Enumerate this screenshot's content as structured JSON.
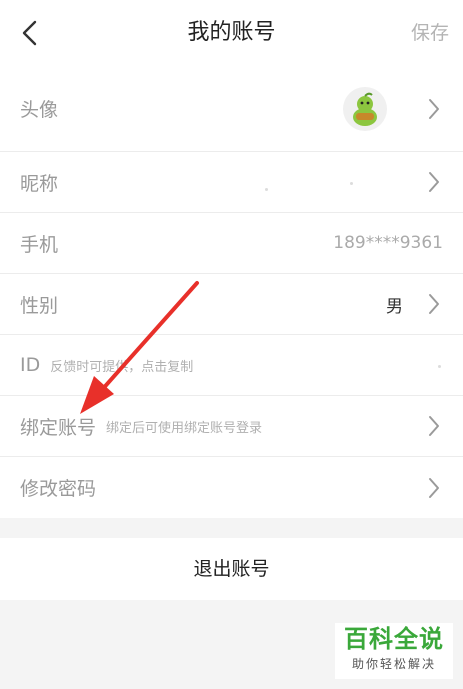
{
  "header": {
    "title": "我的账号",
    "save_label": "保存"
  },
  "rows": [
    {
      "label": "头像"
    },
    {
      "label": "昵称"
    },
    {
      "label": "手机",
      "value": "189****9361"
    },
    {
      "label": "性别",
      "value": "男"
    },
    {
      "label": "ID",
      "hint": "反馈时可提供，点击复制"
    },
    {
      "label": "绑定账号",
      "hint": "绑定后可使用绑定账号登录"
    },
    {
      "label": "修改密码"
    }
  ],
  "logout_label": "退出账号",
  "watermark": {
    "main": "百科全说",
    "sub": "助你轻松解决"
  },
  "colors": {
    "annotation_arrow": "#e8302a",
    "watermark_green": "#3aa83a"
  },
  "icons": [
    "back-chevron-icon",
    "chevron-right-icon",
    "avatar-icon"
  ]
}
